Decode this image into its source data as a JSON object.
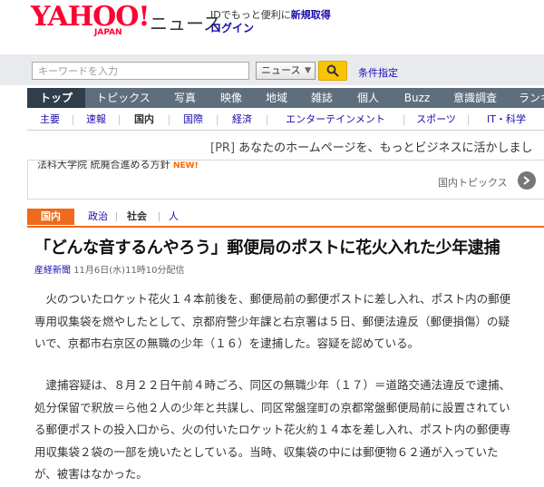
{
  "header": {
    "logo_text": "YAHOO!",
    "logo_sub": "JAPAN",
    "site_name": "ニュース",
    "login_prompt": "IDでもっと便利に",
    "register_link": "新規取得",
    "login_link": "ログイン"
  },
  "search": {
    "placeholder": "キーワードを入力",
    "scope": "ニュース",
    "advanced": "条件指定"
  },
  "nav": {
    "tabs": [
      "トップ",
      "トピックス",
      "写真",
      "映像",
      "地域",
      "雑誌",
      "個人",
      "Buzz",
      "意識調査",
      "ランキ"
    ]
  },
  "subnav": {
    "items": [
      "主要",
      "速報",
      "国内",
      "国際",
      "経済",
      "エンターテインメント",
      "スポーツ",
      "IT・科学"
    ]
  },
  "pr": {
    "tag": "[PR]",
    "text": "あなたのホームページを、もっとビジネスに活かしまし"
  },
  "topics": {
    "headline": "法科大学院 統廃合進める方針",
    "new_badge": "NEW!",
    "more_label": "国内トピックス"
  },
  "category": {
    "main": "国内",
    "items": [
      "政治",
      "社会",
      "人"
    ]
  },
  "article": {
    "title": "「どんな音するんやろう」郵便局のポストに花火入れた少年逮捕",
    "source": "産経新聞",
    "datetime": "11月6日(水)11時10分配信",
    "paragraph1": "　火のついたロケット花火１４本前後を、郵便局前の郵便ポストに差し入れ、ポスト内の郵便\n専用収集袋を燃やしたとして、京都府警少年課と右京署は５日、郵便法違反（郵便損傷）の疑\nいで、京都市右京区の無職の少年（１６）を逮捕した。容疑を認めている。",
    "paragraph2": "　逮捕容疑は、８月２２日午前４時ごろ、同区の無職少年（１７）＝道路交通法違反で逮捕、\n処分保留で釈放＝ら他２人の少年と共謀し、同区常盤窪町の京都常盤郵便局前に設置されてい\nる郵便ポストの投入口から、火の付いたロケット花火約１４本を差し入れ、ポスト内の郵便専\n用収集袋２袋の一部を焼いたとしている。当時、収集袋の中には郵便物６２通が入っていた\nが、被害はなかった。"
  }
}
